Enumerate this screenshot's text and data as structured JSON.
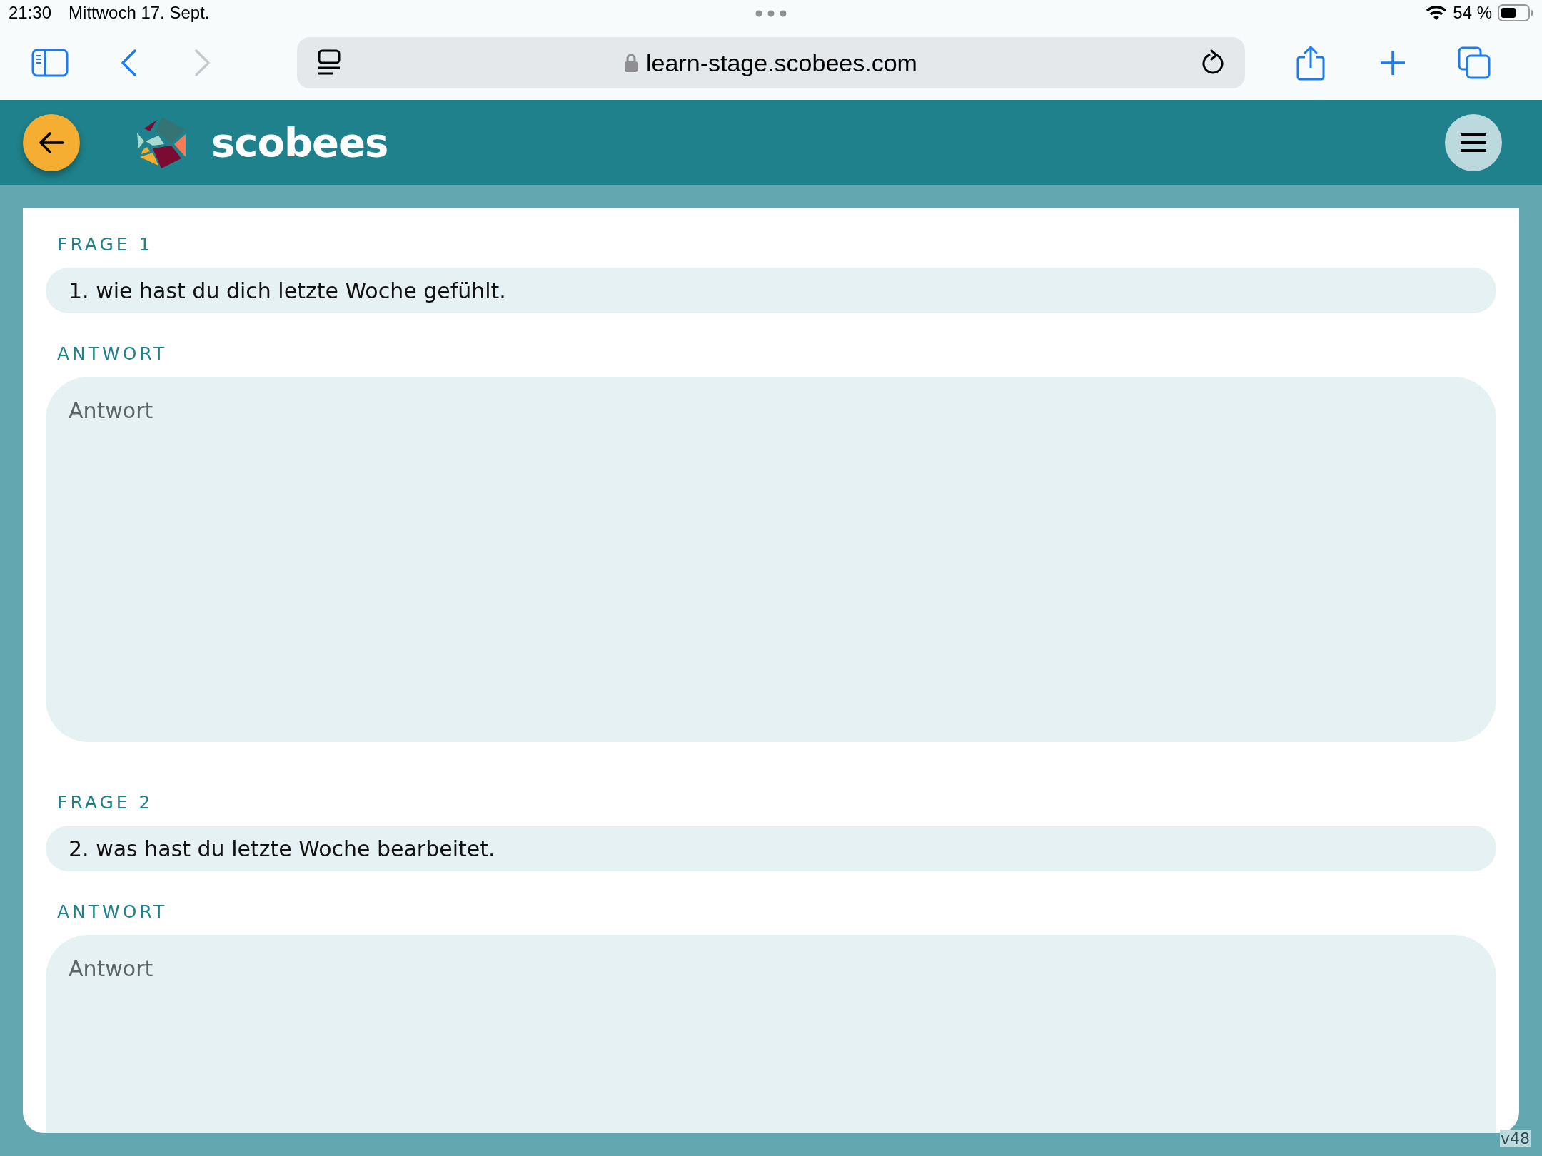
{
  "status_bar": {
    "time": "21:30",
    "date": "Mittwoch 17. Sept.",
    "battery": "54 %"
  },
  "browser": {
    "url": "learn-stage.scobees.com",
    "back": {
      "disabled": false
    },
    "forward": {
      "disabled": true
    }
  },
  "app_header": {
    "brand": "scobees"
  },
  "questions": [
    {
      "label": "FRAGE 1",
      "question": "1. wie hast du dich letzte Woche gefühlt.",
      "answer_label": "ANTWORT",
      "answer": {
        "placeholder": "Antwort"
      }
    },
    {
      "label": "FRAGE 2",
      "question": "2. was hast du letzte Woche bearbeitet.",
      "answer_label": "ANTWORT",
      "answer": {
        "placeholder": "Antwort"
      }
    }
  ],
  "version": "v48"
}
